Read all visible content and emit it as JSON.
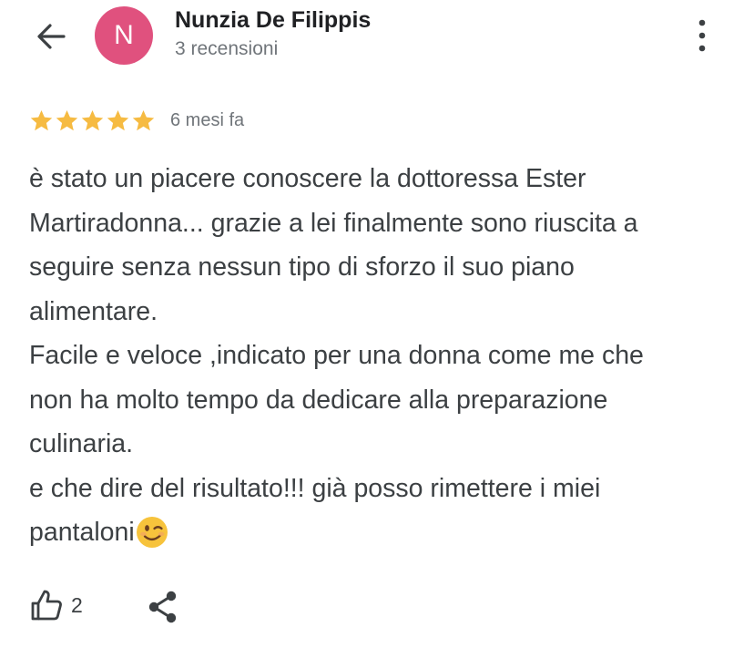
{
  "header": {
    "back_icon": "arrow-left-icon",
    "avatar_letter": "N",
    "avatar_color": "#e0517e",
    "author_name": "Nunzia De Filippis",
    "review_count": "3 recensioni",
    "more_icon": "vertical-dots-icon"
  },
  "review": {
    "rating": 5,
    "rating_max": 5,
    "star_color": "#f6bb42",
    "date": "6 mesi fa",
    "lines": [
      "è stato un piacere conoscere la dottoressa Ester",
      "Martiradonna... grazie a lei finalmente sono riuscita a",
      "seguire senza nessun tipo di sforzo il suo piano",
      "alimentare.",
      "Facile e veloce ,indicato per una donna come me che",
      "non ha molto tempo da dedicare alla preparazione",
      "culinaria.",
      "e che dire del risultato!!! già posso rimettere i miei",
      "pantaloni"
    ],
    "trailing_emoji": "winking-face-emoji"
  },
  "actions": {
    "like_icon": "thumbs-up-icon",
    "like_count": "2",
    "share_icon": "share-icon"
  }
}
